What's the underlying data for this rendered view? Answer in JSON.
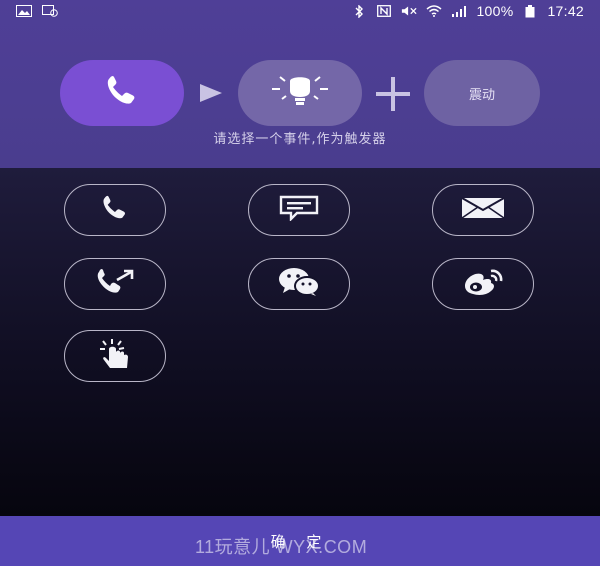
{
  "status_bar": {
    "battery": "100%",
    "time": "17:42"
  },
  "flow": {
    "trigger_icon": "phone-icon",
    "action_icon": "light-bulb-icon",
    "vibrate_label": "震动"
  },
  "hint": "请选择一个事件,作为触发器",
  "events": [
    {
      "icon": "phone-icon"
    },
    {
      "icon": "sms-icon"
    },
    {
      "icon": "mail-icon"
    },
    {
      "icon": "outgoing-call-icon"
    },
    {
      "icon": "wechat-icon"
    },
    {
      "icon": "weibo-icon"
    },
    {
      "icon": "tap-icon"
    }
  ],
  "footer": {
    "confirm_label": "确 定"
  },
  "watermark": "11玩意儿 WYX.COM",
  "colors": {
    "header": "#4f3f97",
    "accent": "#7a4fd3",
    "footer": "#5546b5"
  }
}
